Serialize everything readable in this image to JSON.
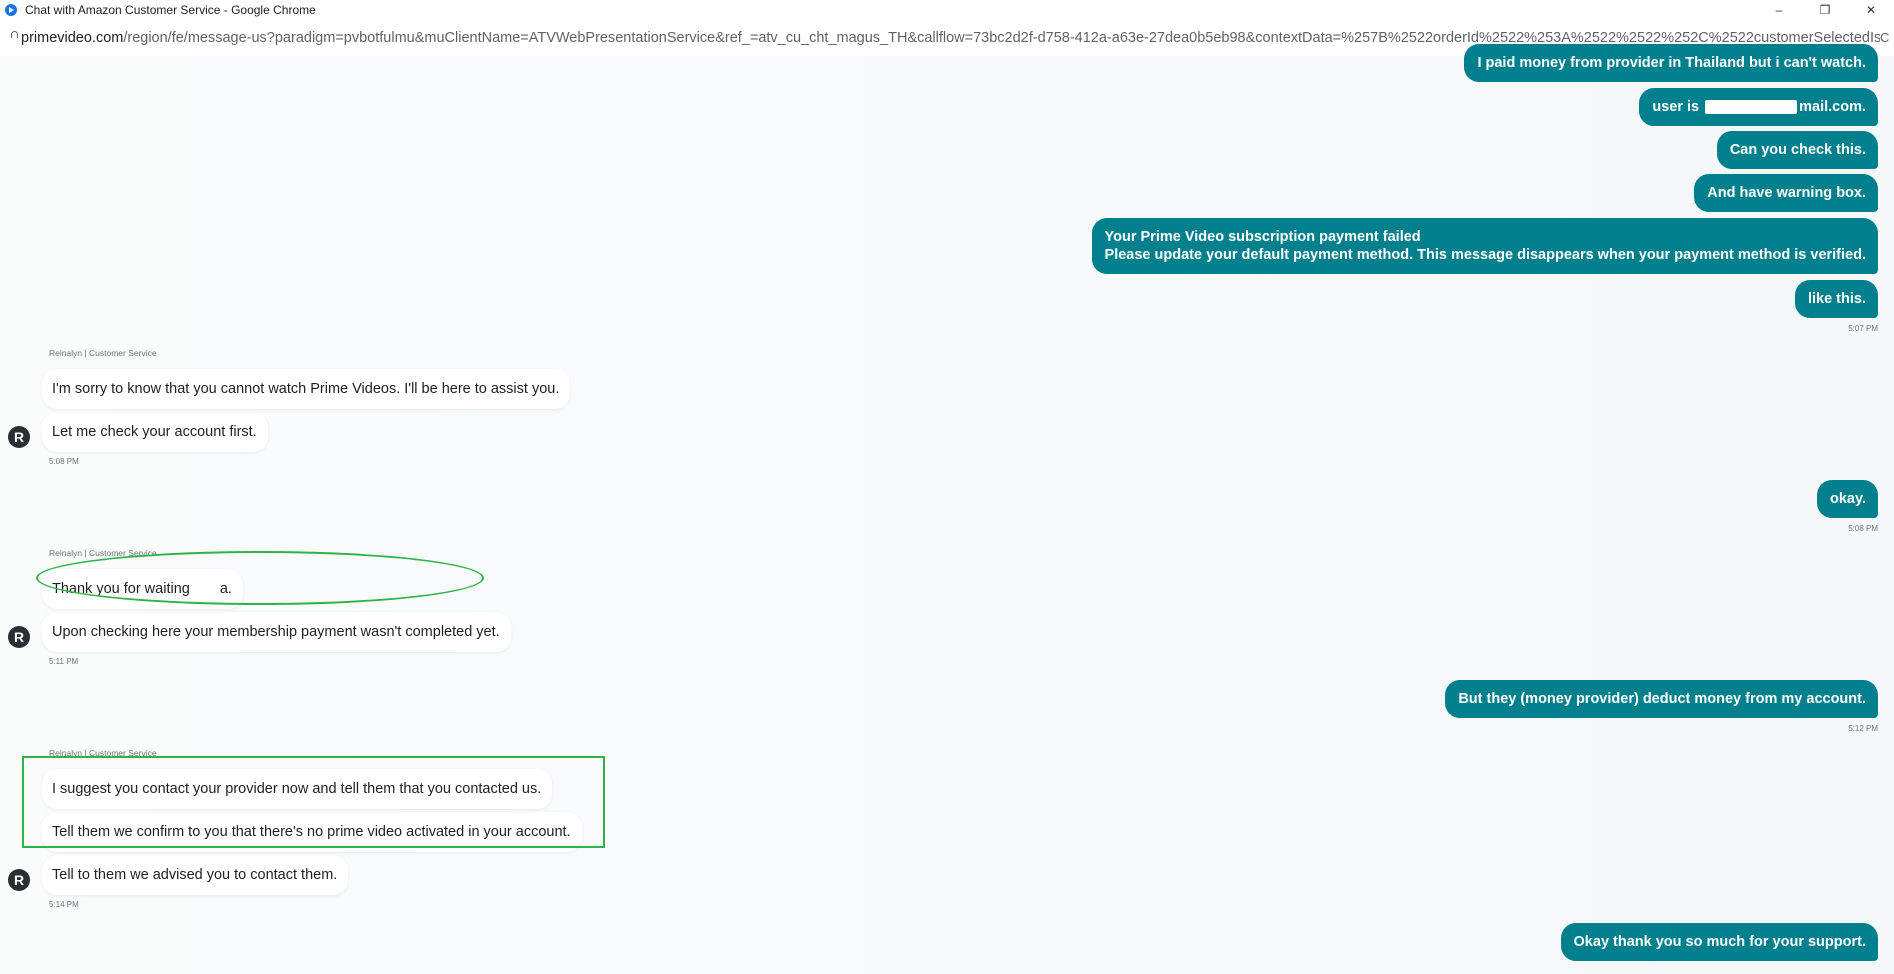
{
  "window": {
    "title": "Chat with Amazon Customer Service - Google Chrome",
    "controls": {
      "minimize": "–",
      "restore": "❐",
      "close": "✕"
    }
  },
  "address": {
    "domain": "primevideo.com",
    "path": "/region/fe/message-us?paradigm=pvbotfulmu&muClientName=ATVWebPresentationService&ref_=atv_cu_cht_magus_TH&callflow=73bc2d2f-d758-412a-a63e-27dea0b5eb98&contextData=%257B%2522orderId%2522%253A%2522%2522%252C%2522customerSelectedIssues%252...",
    "end_glyph": "C"
  },
  "chat": {
    "agent_label": "Reinalyn | Customer Service",
    "avatar_letter": "R",
    "messages": {
      "u1": "I paid money from provider in Thailand but i can't watch.",
      "u2_prefix": "user is",
      "u2_suffix": "mail.com.",
      "u3": "Can you check this.",
      "u4": "And have warning box.",
      "u5_line1": "Your Prime Video subscription payment failed",
      "u5_line2": "Please update your default payment method. This message disappears when your payment method is verified.",
      "u6": "like this.",
      "t1": "5:07 PM",
      "a1": "I'm sorry to know that you cannot watch Prime Videos. I'll be here to assist you.",
      "a2": "Let me check your account first.",
      "t2": "5:08 PM",
      "u7": "okay.",
      "t3": "5:08 PM",
      "a3_prefix": "Thank you for waiting",
      "a3_suffix": "a.",
      "a4": "Upon checking here your membership payment wasn't completed yet.",
      "t4": "5:11 PM",
      "u8": "But they (money provider) deduct money from my account.",
      "t5": "5:12 PM",
      "a5": "I suggest you contact your provider now and tell them that you contacted us.",
      "a6": "Tell them we confirm to you that there's no prime video activated in your account.",
      "a7": "Tell to them we advised you to contact them.",
      "t6": "5:14 PM",
      "u9": "Okay thank you so much for your support."
    }
  }
}
